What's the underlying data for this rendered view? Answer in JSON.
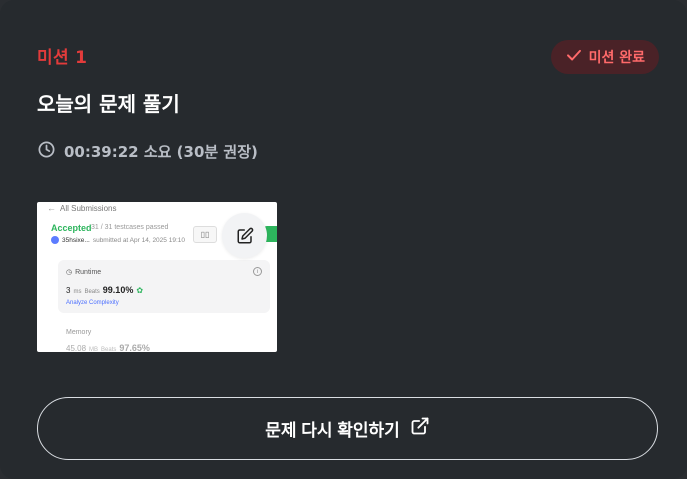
{
  "mission": {
    "label": "미션 1",
    "badge_label": "미션 완료",
    "title": "오늘의 문제 풀기",
    "time_text": "00:39:22 소요 (30분 권장)"
  },
  "thumbnail": {
    "back_label": "All Submissions",
    "status": "Accepted",
    "testcases": "31 / 31 testcases passed",
    "user": "35hsixe...",
    "submitted": "submitted at Apr 14, 2025 19:10",
    "runtime_label": "Runtime",
    "runtime_value": "3",
    "runtime_unit": "ms",
    "beats_label": "Beats",
    "runtime_beats": "99.10%",
    "complexity_link": "Analyze Complexity",
    "memory_label": "Memory",
    "memory_value": "45.08",
    "memory_unit": "MB",
    "memory_beats": "97.65%"
  },
  "actions": {
    "recheck_label": "문제 다시 확인하기"
  },
  "colors": {
    "accent_red": "#e23b3b",
    "badge_bg": "#4a2227",
    "badge_text": "#ff6a6a",
    "background": "#262a2e",
    "muted_text": "#b9bec6"
  },
  "icons": {
    "badge": "check-icon",
    "time": "clock-icon",
    "thumbnail_action": "edit-icon",
    "button": "external-link-icon"
  }
}
